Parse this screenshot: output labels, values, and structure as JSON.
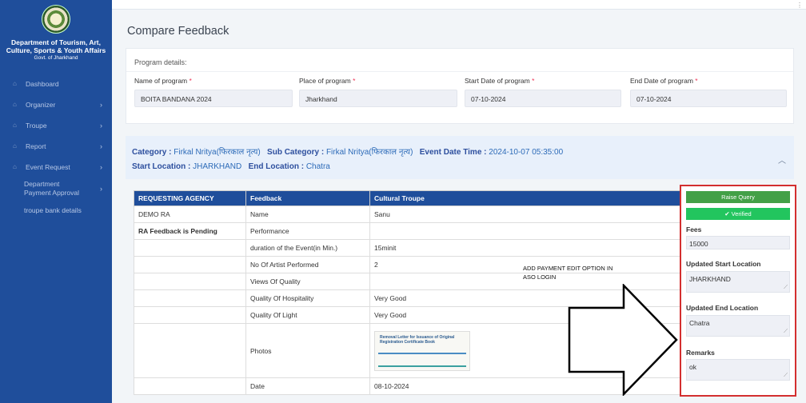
{
  "sidebar": {
    "dept_name": "Department of Tourism, Art, Culture, Sports & Youth Affairs",
    "govt": "Govt. of Jharkhand",
    "items": [
      {
        "label": "Dashboard",
        "icon": "home-icon"
      },
      {
        "label": "Organizer",
        "icon": "home-icon"
      },
      {
        "label": "Troupe",
        "icon": "home-icon"
      },
      {
        "label": "Report",
        "icon": "home-icon"
      },
      {
        "label": "Event Request",
        "icon": "home-icon"
      },
      {
        "label": "Department Payment Approval"
      },
      {
        "label": "troupe bank details"
      }
    ],
    "chevron": "›"
  },
  "page": {
    "title": "Compare Feedback"
  },
  "program": {
    "section_title": "Program details:",
    "name_label": "Name of program",
    "name_value": "BOITA BANDANA 2024",
    "place_label": "Place of program",
    "place_value": "Jharkhand",
    "start_label": "Start Date of program",
    "start_value": "07-10-2024",
    "end_label": "End Date of program",
    "end_value": "07-10-2024",
    "req": "*"
  },
  "category": {
    "cat_label": "Category :",
    "cat_value": "Firkal Nritya(फिरकाल नृत्य)",
    "sub_label": "Sub Category :",
    "sub_value": "Firkal Nritya(फिरकाल नृत्य)",
    "time_label": "Event Date Time :",
    "time_value": "2024-10-07 05:35:00",
    "start_label": "Start Location :",
    "start_value": "JHARKHAND",
    "end_label": "End Location :",
    "end_value": "Chatra"
  },
  "table": {
    "headers": [
      "REQUESTING AGENCY",
      "Feedback",
      "Cultural Troupe"
    ],
    "rows": [
      [
        "DEMO RA",
        "Name",
        "Sanu"
      ],
      [
        "RA Feedback is Pending",
        "Performance",
        ""
      ],
      [
        "",
        "duration of the Event(in Min.)",
        "15minit"
      ],
      [
        "",
        "No Of Artist Performed",
        "2"
      ],
      [
        "",
        "Views Of Quality",
        ""
      ],
      [
        "",
        "Quality Of Hospitality",
        "Very Good"
      ],
      [
        "",
        "Quality Of Light",
        "Very Good"
      ],
      [
        "",
        "Photos",
        ""
      ],
      [
        "",
        "Date",
        "08-10-2024"
      ]
    ],
    "photo_caption": "Removal Letter for Issuance of Original Registration Certificate Book"
  },
  "annotation": {
    "line1": "ADD PAYMENT EDIT OPTION IN",
    "line2": "ASO LOGIN"
  },
  "panel": {
    "raise_query": "Raise Query",
    "verified": "✔ Verified",
    "fees_label": "Fees",
    "fees_value": "15000",
    "upd_start_label": "Updated Start Location",
    "upd_start_value": "JHARKHAND",
    "upd_end_label": "Updated End Location",
    "upd_end_value": "Chatra",
    "remarks_label": "Remarks",
    "remarks_value": "ok"
  },
  "colors": {
    "sidebar": "#1f4e9b",
    "highlight_border": "#d32f2f",
    "verified": "#22c55e",
    "query": "#43a047"
  }
}
